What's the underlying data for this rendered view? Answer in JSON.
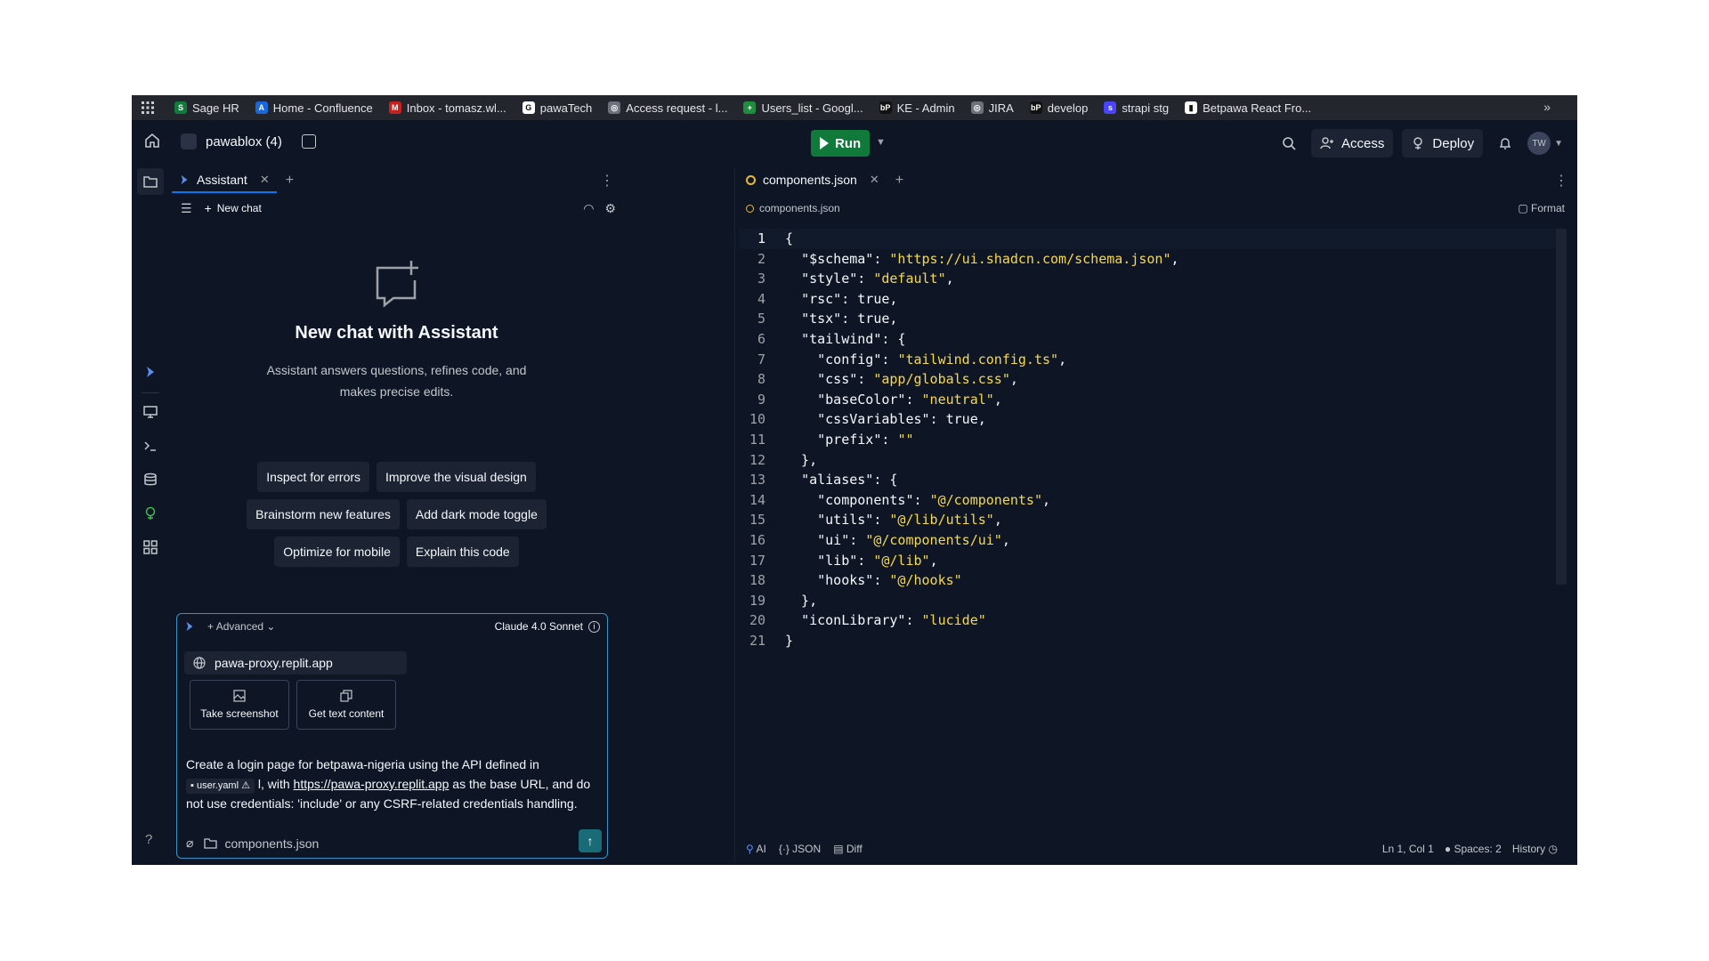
{
  "bookmarks": [
    {
      "label": "Sage HR",
      "color": "#0f7a3a",
      "glyph": "S"
    },
    {
      "label": "Home - Confluence",
      "color": "#1868db",
      "glyph": "A"
    },
    {
      "label": "Inbox - tomasz.wl...",
      "color": "#c5221f",
      "glyph": "M"
    },
    {
      "label": "pawaTech",
      "color": "#ffffff",
      "glyph": "G"
    },
    {
      "label": "Access request - l...",
      "color": "#6c717a",
      "glyph": "◎"
    },
    {
      "label": "Users_list - Googl...",
      "color": "#1e8e3e",
      "glyph": "+"
    },
    {
      "label": "KE - Admin",
      "color": "#111111",
      "glyph": "bP"
    },
    {
      "label": "JIRA",
      "color": "#6c717a",
      "glyph": "◎"
    },
    {
      "label": "develop",
      "color": "#111111",
      "glyph": "bP"
    },
    {
      "label": "strapi stg",
      "color": "#4945ff",
      "glyph": "s"
    },
    {
      "label": "Betpawa React Fro...",
      "color": "#ffffff",
      "glyph": "▮"
    }
  ],
  "topbar": {
    "repl_name": "pawablox (4)",
    "run_label": "Run",
    "access_label": "Access",
    "deploy_label": "Deploy",
    "avatar_initials": "TW"
  },
  "assistant": {
    "tab_label": "Assistant",
    "new_chat_label": "New chat",
    "empty_title": "New chat with Assistant",
    "empty_desc": "Assistant answers questions, refines code, and makes precise edits.",
    "suggestions": [
      "Inspect for errors",
      "Improve the visual design",
      "Brainstorm new features",
      "Add dark mode toggle",
      "Optimize for mobile",
      "Explain this code"
    ]
  },
  "composer": {
    "mode_label": "Advanced",
    "model_label": "Claude 4.0 Sonnet",
    "url_chip": "pawa-proxy.replit.app",
    "screenshot_label": "Take screenshot",
    "text_content_label": "Get text content",
    "prompt_part1": "Create a login page for betpawa-nigeria using the API defined in ",
    "file_ref": "user.yaml",
    "prompt_part2": " l, with ",
    "prompt_link": "https://pawa-proxy.replit.app",
    "prompt_part3": " as the base URL, and do not use credentials: 'include' or any CSRF-related credentials handling.",
    "attached_file": "components.json"
  },
  "editor": {
    "tab_label": "components.json",
    "breadcrumb": "components.json",
    "format_label": "Format",
    "lines": [
      "{",
      "  \"$schema\": \"https://ui.shadcn.com/schema.json\",",
      "  \"style\": \"default\",",
      "  \"rsc\": true,",
      "  \"tsx\": true,",
      "  \"tailwind\": {",
      "    \"config\": \"tailwind.config.ts\",",
      "    \"css\": \"app/globals.css\",",
      "    \"baseColor\": \"neutral\",",
      "    \"cssVariables\": true,",
      "    \"prefix\": \"\"",
      "  },",
      "  \"aliases\": {",
      "    \"components\": \"@/components\",",
      "    \"utils\": \"@/lib/utils\",",
      "    \"ui\": \"@/components/ui\",",
      "    \"lib\": \"@/lib\",",
      "    \"hooks\": \"@/hooks\"",
      "  },",
      "  \"iconLibrary\": \"lucide\"",
      "}"
    ],
    "current_line": 1
  },
  "statusbar": {
    "ai_label": "AI",
    "json_label": "JSON",
    "diff_label": "Diff",
    "cursor_pos": "Ln 1, Col 1",
    "spaces_label": "Spaces: 2",
    "history_label": "History"
  },
  "colors": {
    "accent": "#0079f2",
    "run_green": "#0f7a3a",
    "string_yellow": "#f7d94c",
    "background": "#0e1525"
  }
}
